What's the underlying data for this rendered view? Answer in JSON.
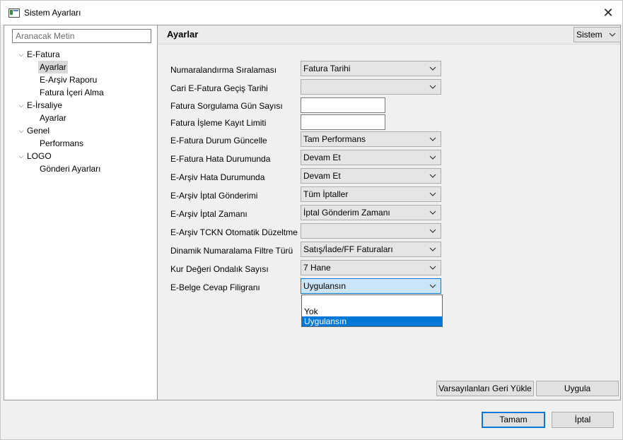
{
  "window": {
    "title": "Sistem Ayarları",
    "close_glyph": "✕"
  },
  "search": {
    "placeholder": "Aranacak Metin"
  },
  "tree": [
    {
      "label": "E-Fatura",
      "level": 0,
      "expanded": true
    },
    {
      "label": "Ayarlar",
      "level": 1,
      "selected": true
    },
    {
      "label": "E-Arşiv Raporu",
      "level": 1
    },
    {
      "label": "Fatura İçeri Alma",
      "level": 1
    },
    {
      "label": "E-İrsaliye",
      "level": 0,
      "expanded": true
    },
    {
      "label": "Ayarlar",
      "level": 1
    },
    {
      "label": "Genel",
      "level": 0,
      "expanded": true
    },
    {
      "label": "Performans",
      "level": 1
    },
    {
      "label": "LOGO",
      "level": 0,
      "expanded": true
    },
    {
      "label": "Gönderi Ayarları",
      "level": 1
    }
  ],
  "header": {
    "title": "Ayarlar",
    "scope_value": "Sistem"
  },
  "form": [
    {
      "label": "Numaralandırma Sıralaması",
      "type": "combo",
      "value": "Fatura Tarihi"
    },
    {
      "label": "Cari E-Fatura Geçiş Tarihi",
      "type": "combo",
      "value": ""
    },
    {
      "label": "Fatura Sorgulama Gün Sayısı",
      "type": "text",
      "value": ""
    },
    {
      "label": "Fatura İşleme Kayıt Limiti",
      "type": "text",
      "value": ""
    },
    {
      "label": "E-Fatura Durum Güncelle",
      "type": "combo",
      "value": "Tam Performans"
    },
    {
      "label": "E-Fatura Hata Durumunda",
      "type": "combo",
      "value": "Devam Et"
    },
    {
      "label": "E-Arşiv Hata Durumunda",
      "type": "combo",
      "value": "Devam Et"
    },
    {
      "label": "E-Arşiv İptal Gönderimi",
      "type": "combo",
      "value": "Tüm İptaller"
    },
    {
      "label": "E-Arşiv İptal Zamanı",
      "type": "combo",
      "value": "İptal Gönderim Zamanı"
    },
    {
      "label": "E-Arşiv TCKN Otomatik Düzeltme",
      "type": "combo",
      "value": ""
    },
    {
      "label": "Dinamik Numaralama Filtre Türü",
      "type": "combo",
      "value": "Satış/İade/FF Faturaları"
    },
    {
      "label": "Kur Değeri Ondalık Sayısı",
      "type": "combo",
      "value": "7 Hane"
    },
    {
      "label": "E-Belge Cevap Filigranı",
      "type": "combo",
      "value": "Uygulansın",
      "focused": true
    }
  ],
  "dropdown": {
    "options": [
      "",
      "Yok",
      "Uygulansın"
    ],
    "selected_index": 2
  },
  "buttons": {
    "reset": "Varsayılanları Geri Yükle",
    "apply": "Uygula",
    "ok": "Tamam",
    "cancel": "İptal"
  },
  "colors": {
    "accent": "#0078d7",
    "focus_fill": "#cce4f7",
    "selected_tree": "#d9d9d9"
  }
}
